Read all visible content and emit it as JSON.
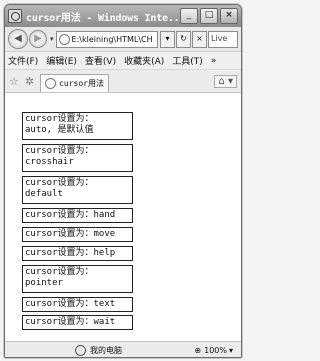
{
  "window": {
    "title": "cursor用法 - Windows Inte..."
  },
  "window_controls": {
    "minimize": "_",
    "maximize": "□",
    "close": "×"
  },
  "address": {
    "back_glyph": "◀",
    "forward_glyph": "▶",
    "dropdown_glyph": "▾",
    "url": "E:\\kleining\\HTML\\CH",
    "go_glyph": "▾",
    "refresh_glyph": "↻",
    "stop_glyph": "×",
    "search_text": "Live"
  },
  "menu": [
    {
      "label": "文件(F)"
    },
    {
      "label": "编辑(E)"
    },
    {
      "label": "查看(V)"
    },
    {
      "label": "收藏夹(A)"
    },
    {
      "label": "工具(T)"
    },
    {
      "label": "»"
    }
  ],
  "tabs": {
    "favorites_glyph": "☆",
    "add_favorite_glyph": "✲",
    "active_label": "cursor用法",
    "home_glyph": "⌂ ▾"
  },
  "cursor_items": [
    {
      "label": "cursor设置为：",
      "value": "auto, 是默认值"
    },
    {
      "label": "cursor设置为：",
      "value": "crosshair"
    },
    {
      "label": "cursor设置为：",
      "value": "default"
    },
    {
      "label": "cursor设置为：hand",
      "value": ""
    },
    {
      "label": "cursor设置为：move",
      "value": ""
    },
    {
      "label": "cursor设置为：help",
      "value": ""
    },
    {
      "label": "cursor设置为：",
      "value": "pointer"
    },
    {
      "label": "cursor设置为：text",
      "value": ""
    },
    {
      "label": "cursor设置为：wait",
      "value": ""
    }
  ],
  "status": {
    "zone": "我的电脑",
    "zoom": "100%",
    "zoom_dropdown": "▾",
    "zoom_glyph": "⊕"
  }
}
